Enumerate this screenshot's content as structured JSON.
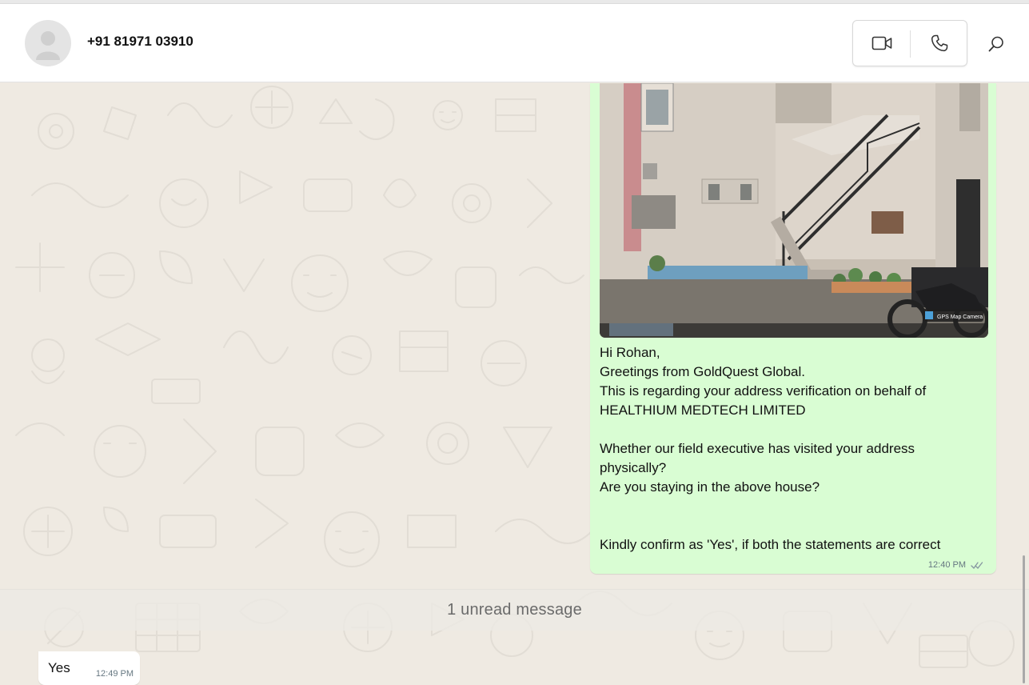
{
  "header": {
    "contact_name": "+91 81971 03910",
    "icons": {
      "avatar": "default-avatar-icon",
      "video": "video-call-icon",
      "voice": "voice-call-icon",
      "search": "search-icon"
    }
  },
  "chat": {
    "outgoing_message": {
      "image_label": "house-photo",
      "image_watermark": "GPS Map Camera",
      "lines": [
        "Hi Rohan,",
        "Greetings from GoldQuest Global.",
        "This is regarding your address verification on behalf of",
        "HEALTHIUM MEDTECH LIMITED",
        "",
        "Whether our field executive has visited your address",
        "physically?",
        "Are you staying in the above house?",
        "",
        "",
        "Kindly confirm as 'Yes', if both the statements are correct"
      ],
      "time": "12:40 PM",
      "status_icon": "double-check-icon"
    },
    "unread_banner": "1 unread message",
    "incoming_message": {
      "text": "Yes",
      "time": "12:49 PM"
    }
  },
  "colors": {
    "outgoing_bubble": "#d9fdd3",
    "incoming_bubble": "#ffffff",
    "chat_background": "#efeae2",
    "meta_text": "#667781"
  }
}
